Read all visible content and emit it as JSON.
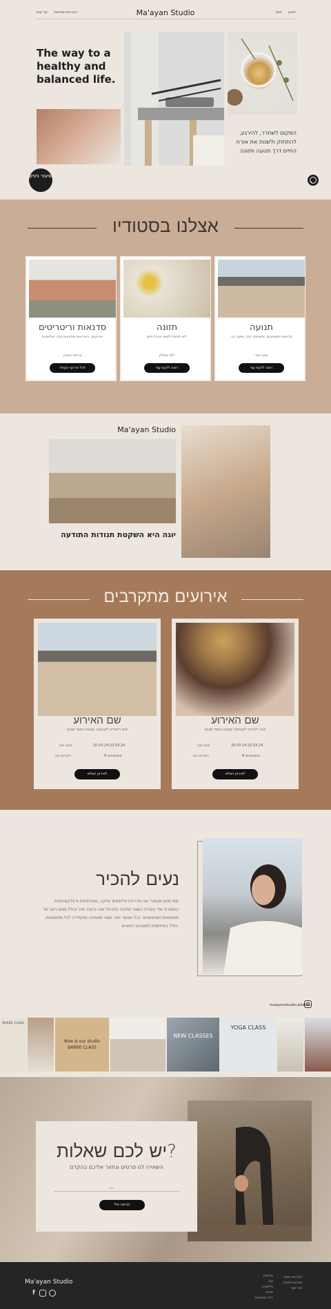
{
  "header": {
    "logo": "Ma'ayan Studio",
    "nav_left": [
      "צור קשר",
      "ריטריטים וסדנאות"
    ],
    "nav_right": [
      "חנות",
      "לוגאין"
    ]
  },
  "hero": {
    "headline": "The way to a healthy and balanced life.",
    "tagline": "המקום לשחרר, להירגע, להתחזק ולשנות את אורח החיים דרך תנועה ותזונה",
    "cta": "שיעור ניסיון"
  },
  "studio": {
    "title": "אצלנו בסטודיו",
    "cards": [
      {
        "title": "סדנאות וריטריטים",
        "sub": "אירועים, ריטריטים וסדנאות יוגה, פילאטיס",
        "meta": "ברחבי הארץ",
        "button": "לכל אירועי העתיד"
      },
      {
        "title": "תזונה",
        "sub": "ליווי תזונתי לשינוי אורח חיים",
        "meta": "ליווי אונליין",
        "button": "רוצה לדעת עוד"
      },
      {
        "title": "תנועה",
        "sub": "סדנאות ומשאבים, אשטנגה יוגה, שיעור בר",
        "meta": "כוכב יאיר",
        "button": "רוצה לדעת עוד"
      }
    ]
  },
  "yoga": {
    "brand": "Ma'ayan Studio",
    "caption": "יוגה היא השקטת תנודות התודעה"
  },
  "events": {
    "title": "אירועים מתקרבים",
    "items": [
      {
        "title": "שם האירוע",
        "sub": "יוגה ריטריט לקבוצה קטנה בסוף שבוע",
        "date": "20.03.24-22.03.24",
        "location": "כוכב יאיר",
        "spots": "8 משתתפים",
        "type": "ריטריט יוגה",
        "button": "לאירוע המלא"
      },
      {
        "title": "שם האירוע",
        "sub": "יוגה ריטריט לקבוצה קטנה בסוף שבוע",
        "date": "20.03.24-22.03.24",
        "location": "כוכב יאיר",
        "spots": "8 משתתפים",
        "type": "ריטריט יוגה",
        "button": "לאירוע המלא"
      }
    ]
  },
  "about": {
    "title": "נעים להכיר",
    "body": "שמי מעין מטפורי אני מדריכת פילאטיס ותיקה, נטורופתית ורפלקסולוגית. המסורת שלי עובדת כשאני שלובה בתרגול יוגה בכוכב יאיר וכולל מגוון רחב של מתאמנות ומתאמנים. ככל אפשר יותר שאני מאמינה ומקפידה לכל מתאמנות, כולל התייחסות למצבים רפואיים."
  },
  "instagram": {
    "handle": "maayanstudio.pilates",
    "tiles": [
      "BARRE CLASS",
      "Now is our studio BARRE CLASS",
      "NEW CLASSES",
      "YOGA CLASS"
    ]
  },
  "questions": {
    "title": "יש לכם שאלות?",
    "sub": "השאירו לנו פרטים ונחזור אליכם בהקדם",
    "field_label": "מייל",
    "button": "קדימה שלי"
  },
  "footer": {
    "logo": "Ma'ayan Studio",
    "col1": [
      "לקביעת שיעור",
      "שאלות נפוצות",
      "צור קשר"
    ],
    "col2": [
      "סדנאות",
      "יוגה",
      "פילאטיס",
      "אודות",
      "לכל הסדנאות"
    ]
  }
}
